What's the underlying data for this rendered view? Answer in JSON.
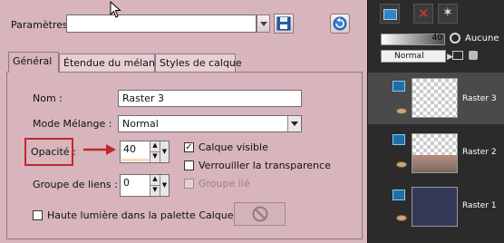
{
  "top_bar": {
    "preset_label": "Paramètres",
    "preset_value": ""
  },
  "tabs": [
    "Général",
    "Étendue du mélange",
    "Styles de calque"
  ],
  "fields": {
    "name_label": "Nom :",
    "name_value": "Raster 3",
    "blend_label": "Mode Mélange :",
    "blend_value": "Normal",
    "opacity_label": "Opacité :",
    "opacity_value": "40",
    "group_label": "Groupe de liens :",
    "group_value": "0"
  },
  "checkboxes": {
    "visible_label": "Calque visible",
    "visible_checked": true,
    "lock_label": "Verrouiller la transparence",
    "lock_checked": false,
    "group_linked_label": "Groupe lié",
    "group_linked_checked": false,
    "highlight_label": "Haute lumière dans la palette Calques :",
    "highlight_checked": false
  },
  "colors": {
    "dialog_bg": "#d8b4bc",
    "highlight_box": "#c0282e",
    "arrow": "#c0282e"
  },
  "layers_panel": {
    "opacity_value": "40",
    "mask_label": "Aucune",
    "blend_value": "Normal",
    "layers": [
      {
        "name": "Raster 3",
        "selected": true
      },
      {
        "name": "Raster 2",
        "selected": false
      },
      {
        "name": "Raster 1",
        "selected": false
      }
    ]
  }
}
